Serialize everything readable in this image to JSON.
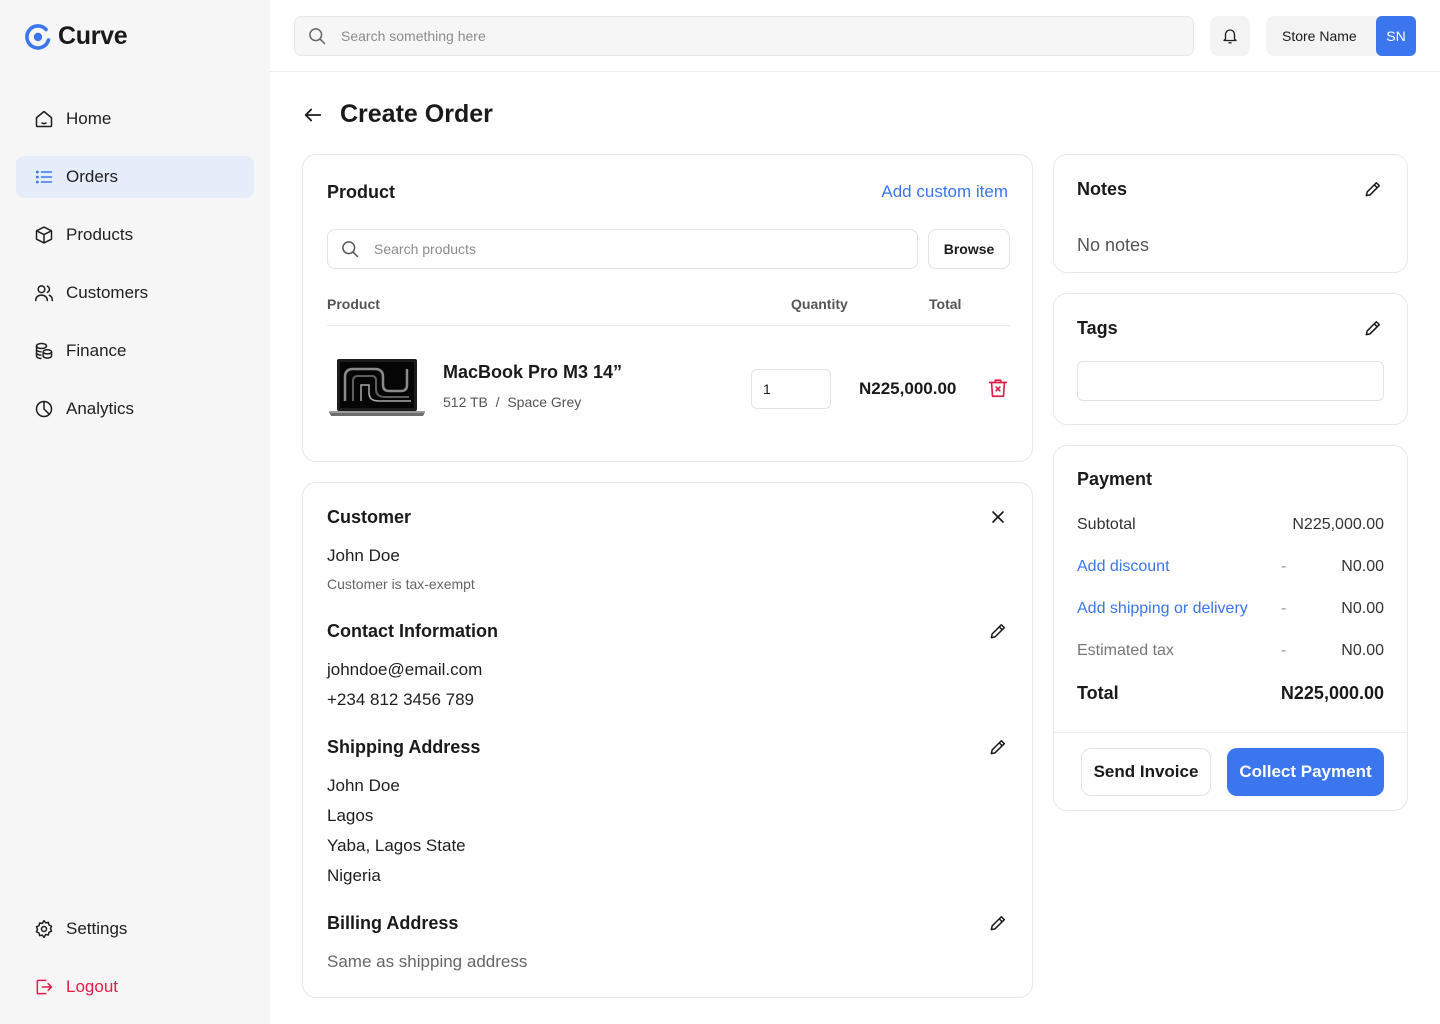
{
  "app": {
    "name": "Curve"
  },
  "sidebar": {
    "items": [
      {
        "label": "Home",
        "icon": "home-icon"
      },
      {
        "label": "Orders",
        "icon": "list-icon",
        "active": true
      },
      {
        "label": "Products",
        "icon": "box-icon"
      },
      {
        "label": "Customers",
        "icon": "users-icon"
      },
      {
        "label": "Finance",
        "icon": "coins-icon"
      },
      {
        "label": "Analytics",
        "icon": "pie-chart-icon"
      }
    ],
    "bottom": [
      {
        "label": "Settings",
        "icon": "gear-icon"
      },
      {
        "label": "Logout",
        "icon": "logout-icon"
      }
    ]
  },
  "topbar": {
    "search_placeholder": "Search something here",
    "store_name": "Store Name",
    "avatar_initials": "SN"
  },
  "page": {
    "title": "Create Order"
  },
  "product_section": {
    "title": "Product",
    "add_custom_label": "Add custom item",
    "search_placeholder": "Search products",
    "browse_label": "Browse",
    "columns": [
      "Product",
      "Quantity",
      "Total"
    ],
    "items": [
      {
        "name": "MacBook Pro M3 14”",
        "variant": "512 TB  /  Space Grey",
        "quantity": "1",
        "total": "N225,000.00"
      }
    ]
  },
  "customer": {
    "title": "Customer",
    "name": "John Doe",
    "tax_note": "Customer is tax-exempt",
    "contact": {
      "title": "Contact Information",
      "email": "johndoe@email.com",
      "phone": "+234 812 3456 789"
    },
    "shipping": {
      "title": "Shipping Address",
      "lines": [
        "John Doe",
        "Lagos",
        "Yaba, Lagos State",
        "Nigeria"
      ]
    },
    "billing": {
      "title": "Billing Address",
      "value": "Same as shipping address"
    }
  },
  "notes": {
    "title": "Notes",
    "value": "No notes"
  },
  "tags": {
    "title": "Tags",
    "value": ""
  },
  "payment": {
    "title": "Payment",
    "subtotal": {
      "label": "Subtotal",
      "value": "N225,000.00"
    },
    "discount": {
      "label": "Add discount",
      "dash": "-",
      "value": "N0.00"
    },
    "shipping": {
      "label": "Add shipping or delivery",
      "dash": "-",
      "value": "N0.00"
    },
    "tax": {
      "label": "Estimated tax",
      "dash": "-",
      "value": "N0.00"
    },
    "total": {
      "label": "Total",
      "value": "N225,000.00"
    },
    "send_invoice_label": "Send Invoice",
    "collect_payment_label": "Collect Payment"
  },
  "colors": {
    "accent": "#3b76ee",
    "danger": "#e11d48",
    "active_nav_bg": "#e5edfb"
  }
}
